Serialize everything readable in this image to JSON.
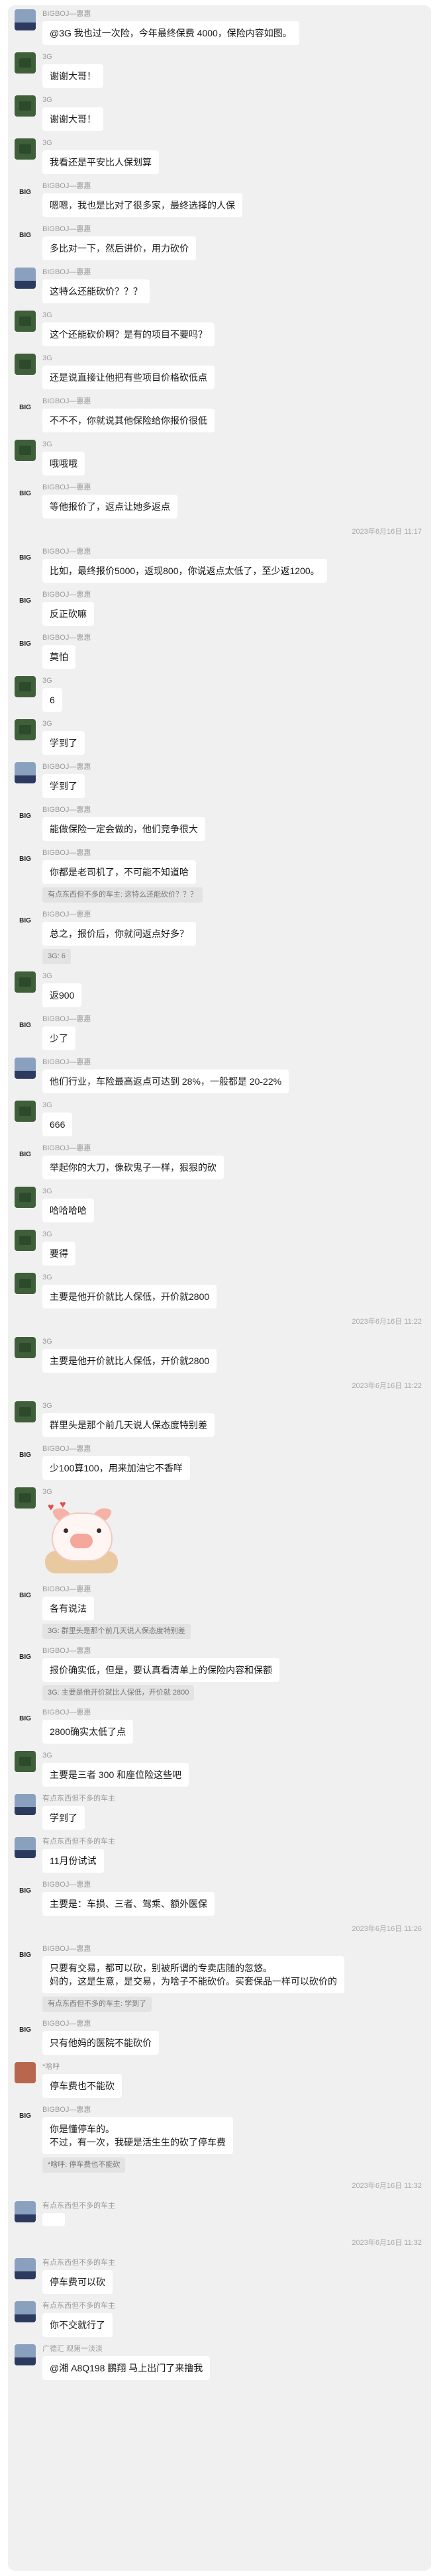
{
  "messages": [
    {
      "kind": "msg",
      "avatar": "sky",
      "name": "BIGBOJ—惠惠",
      "text": "@3G 我也过一次险，今年最终保费 4000，保险内容如图。"
    },
    {
      "kind": "msg",
      "avatar": "green",
      "name": "3G",
      "text": "谢谢大哥！"
    },
    {
      "kind": "msg",
      "avatar": "green",
      "name": "3G",
      "text": "谢谢大哥！"
    },
    {
      "kind": "msg",
      "avatar": "green",
      "name": "3G",
      "text": "我看还是平安比人保划算"
    },
    {
      "kind": "msg",
      "avatar": "text",
      "avatar_text": "BIG",
      "name": "BIGBOJ—惠惠",
      "text": "嗯嗯，我也是比对了很多家，最终选择的人保"
    },
    {
      "kind": "msg",
      "avatar": "text",
      "avatar_text": "BIG",
      "name": "BIGBOJ—惠惠",
      "text": "多比对一下，然后讲价，用力砍价"
    },
    {
      "kind": "msg",
      "avatar": "sky",
      "name": "BIGBOJ—惠惠",
      "text": "这特么还能砍价？？？"
    },
    {
      "kind": "msg",
      "avatar": "green",
      "name": "3G",
      "text": "这个还能砍价啊？是有的项目不要吗？"
    },
    {
      "kind": "msg",
      "avatar": "green",
      "name": "3G",
      "text": "还是说直接让他把有些项目价格砍低点"
    },
    {
      "kind": "msg",
      "avatar": "text",
      "avatar_text": "BIG",
      "name": "BIGBOJ—惠惠",
      "text": "不不不，你就说其他保险给你报价很低"
    },
    {
      "kind": "msg",
      "avatar": "green",
      "name": "3G",
      "text": "哦哦哦"
    },
    {
      "kind": "msg",
      "avatar": "text",
      "avatar_text": "BIG",
      "name": "BIGBOJ—惠惠",
      "text": "等他报价了，返点让她多返点"
    },
    {
      "kind": "time",
      "text": "2023年6月16日 11:17"
    },
    {
      "kind": "msg",
      "avatar": "text",
      "avatar_text": "BIG",
      "name": "BIGBOJ—惠惠",
      "text": "比如，最终报价5000，返现800，你说返点太低了，至少返1200。"
    },
    {
      "kind": "msg",
      "avatar": "text",
      "avatar_text": "BIG",
      "name": "BIGBOJ—惠惠",
      "text": "反正砍嘛"
    },
    {
      "kind": "msg",
      "avatar": "text",
      "avatar_text": "BIG",
      "name": "BIGBOJ—惠惠",
      "text": "莫怕"
    },
    {
      "kind": "msg",
      "avatar": "green",
      "name": "3G",
      "text": "6"
    },
    {
      "kind": "msg",
      "avatar": "green",
      "name": "3G",
      "text": "学到了"
    },
    {
      "kind": "msg",
      "avatar": "sky",
      "name": "BIGBOJ—惠惠",
      "text": "学到了"
    },
    {
      "kind": "msg",
      "avatar": "text",
      "avatar_text": "BIG",
      "name": "BIGBOJ—惠惠",
      "text": "能做保险一定会做的，他们竞争很大"
    },
    {
      "kind": "msg",
      "avatar": "text",
      "avatar_text": "BIG",
      "name": "BIGBOJ—惠惠",
      "text": "你都是老司机了，不可能不知道哈",
      "quote": "有点东西但不多的车主: 这特么还能砍价？？？"
    },
    {
      "kind": "msg",
      "avatar": "text",
      "avatar_text": "BIG",
      "name": "BIGBOJ—惠惠",
      "text": "总之，报价后，你就问返点好多？",
      "quote": "3G: 6"
    },
    {
      "kind": "msg",
      "avatar": "green",
      "name": "3G",
      "text": "返900"
    },
    {
      "kind": "msg",
      "avatar": "text",
      "avatar_text": "BIG",
      "name": "BIGBOJ—惠惠",
      "text": "少了"
    },
    {
      "kind": "msg",
      "avatar": "sky",
      "name": "BIGBOJ—惠惠",
      "text": "他们行业，车险最高返点可达到 28%，一般都是 20-22%"
    },
    {
      "kind": "msg",
      "avatar": "green",
      "name": "3G",
      "text": "666"
    },
    {
      "kind": "msg",
      "avatar": "text",
      "avatar_text": "BIG",
      "name": "BIGBOJ—惠惠",
      "text": "举起你的大刀，像砍鬼子一样，狠狠的砍"
    },
    {
      "kind": "msg",
      "avatar": "green",
      "name": "3G",
      "text": "哈哈哈哈"
    },
    {
      "kind": "msg",
      "avatar": "green",
      "name": "3G",
      "text": "要得"
    },
    {
      "kind": "msg",
      "avatar": "green",
      "name": "3G",
      "text": "主要是他开价就比人保低，开价就2800"
    },
    {
      "kind": "time",
      "text": "2023年6月16日 11:22"
    },
    {
      "kind": "msg",
      "avatar": "green",
      "name": "3G",
      "text": "主要是他开价就比人保低，开价就2800"
    },
    {
      "kind": "time",
      "text": "2023年6月16日 11:22"
    },
    {
      "kind": "msg",
      "avatar": "green",
      "name": "3G",
      "text": "群里头是那个前几天说人保态度特别差"
    },
    {
      "kind": "msg",
      "avatar": "text",
      "avatar_text": "BIG",
      "name": "BIGBOJ—惠惠",
      "text": "少100算100，用来加油它不香咩"
    },
    {
      "kind": "sticker",
      "avatar": "green",
      "name": "3G"
    },
    {
      "kind": "msg",
      "avatar": "text",
      "avatar_text": "BIG",
      "name": "BIGBOJ—惠惠",
      "text": "各有说法",
      "quote": "3G: 群里头是那个前几天说人保态度特别差"
    },
    {
      "kind": "msg",
      "avatar": "text",
      "avatar_text": "BIG",
      "name": "BIGBOJ—惠惠",
      "text": "报价确实低，但是，要认真看清单上的保险内容和保额",
      "quote": "3G: 主要是他开价就比人保低，开价就 2800"
    },
    {
      "kind": "msg",
      "avatar": "text",
      "avatar_text": "BIG",
      "name": "BIGBOJ—惠惠",
      "text": "2800确实太低了点"
    },
    {
      "kind": "msg",
      "avatar": "green",
      "name": "3G",
      "text": "主要是三者 300 和座位险这些吧"
    },
    {
      "kind": "msg",
      "avatar": "sky",
      "name": "有点东西但不多的车主",
      "text": "学到了"
    },
    {
      "kind": "msg",
      "avatar": "sky",
      "name": "有点东西但不多的车主",
      "text": "11月份试试"
    },
    {
      "kind": "msg",
      "avatar": "text",
      "avatar_text": "BIG",
      "name": "BIGBOJ—惠惠",
      "text": "主要是：车损、三者、驾乘、额外医保"
    },
    {
      "kind": "time",
      "text": "2023年6月16日 11:26"
    },
    {
      "kind": "msg",
      "avatar": "text",
      "avatar_text": "BIG",
      "name": "BIGBOJ—惠惠",
      "text": "只要有交易，都可以砍，别被所谓的专卖店随的忽悠。\n妈的，这是生意，是交易，为啥子不能砍价。买套保品一样可以砍价的",
      "quote": "有点东西但不多的车主: 学到了"
    },
    {
      "kind": "msg",
      "avatar": "text",
      "avatar_text": "BIG",
      "name": "BIGBOJ—惠惠",
      "text": "只有他妈的医院不能砍价"
    },
    {
      "kind": "msg",
      "avatar": "char",
      "name": "*啥呼",
      "text": "停车费也不能砍"
    },
    {
      "kind": "msg",
      "avatar": "text",
      "avatar_text": "BIG",
      "name": "BIGBOJ—惠惠",
      "text": "你是懂停车的。\n不过，有一次，我硬是活生生的砍了停车费",
      "quote": "*啥呼: 停车费也不能砍"
    },
    {
      "kind": "time",
      "text": "2023年6月16日 11:32"
    },
    {
      "kind": "msg",
      "avatar": "sky",
      "name": "有点东西但不多的车主",
      "text": ""
    },
    {
      "kind": "time",
      "text": "2023年6月16日 11:32"
    },
    {
      "kind": "msg",
      "avatar": "sky",
      "name": "有点东西但不多的车主",
      "text": "停车费可以砍"
    },
    {
      "kind": "msg",
      "avatar": "sky",
      "name": "有点东西但不多的车主",
      "text": "你不交就行了"
    },
    {
      "kind": "msg",
      "avatar": "sky",
      "name": "广德汇 观第一淡淡",
      "text": "@湘 A8Q198 鹏翔 马上出门了来撸我"
    }
  ]
}
